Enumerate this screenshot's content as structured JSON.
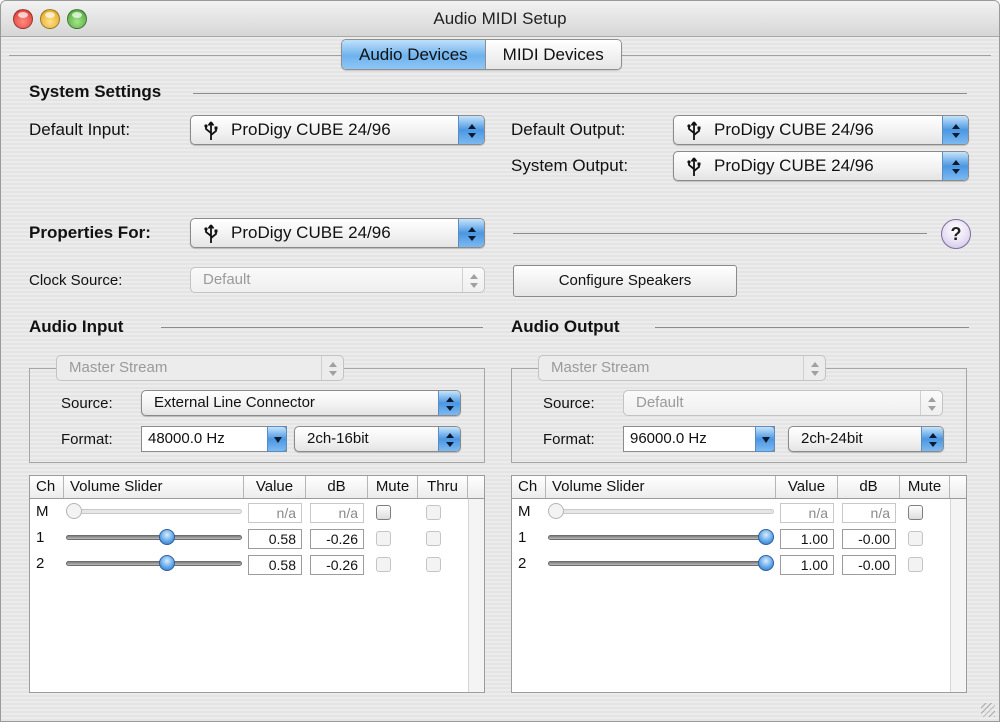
{
  "window": {
    "title": "Audio MIDI Setup"
  },
  "tabs": [
    {
      "label": "Audio Devices",
      "active": true
    },
    {
      "label": "MIDI Devices",
      "active": false
    }
  ],
  "system_settings": {
    "heading": "System Settings",
    "default_input_label": "Default Input:",
    "default_input_value": "ProDigy CUBE 24/96",
    "default_output_label": "Default Output:",
    "default_output_value": "ProDigy CUBE 24/96",
    "system_output_label": "System Output:",
    "system_output_value": "ProDigy CUBE 24/96",
    "device_icon": "usb-icon"
  },
  "properties": {
    "label": "Properties For:",
    "value": "ProDigy CUBE 24/96",
    "help_label": "?",
    "clock_source_label": "Clock Source:",
    "clock_source_value": "Default",
    "configure_speakers_label": "Configure Speakers"
  },
  "audio_input": {
    "heading": "Audio Input",
    "stream": "Master Stream",
    "source_label": "Source:",
    "source_value": "External Line Connector",
    "format_label": "Format:",
    "format_rate": "48000.0 Hz",
    "format_channels": "2ch-16bit",
    "columns": [
      "Ch",
      "Volume Slider",
      "Value",
      "dB",
      "Mute",
      "Thru"
    ],
    "rows": [
      {
        "ch": "M",
        "level": 0.0,
        "enabled": false,
        "value": "n/a",
        "db": "n/a"
      },
      {
        "ch": "1",
        "level": 0.58,
        "enabled": true,
        "value": "0.58",
        "db": "-0.26"
      },
      {
        "ch": "2",
        "level": 0.58,
        "enabled": true,
        "value": "0.58",
        "db": "-0.26"
      }
    ]
  },
  "audio_output": {
    "heading": "Audio Output",
    "stream": "Master Stream",
    "source_label": "Source:",
    "source_value": "Default",
    "format_label": "Format:",
    "format_rate": "96000.0 Hz",
    "format_channels": "2ch-24bit",
    "columns": [
      "Ch",
      "Volume Slider",
      "Value",
      "dB",
      "Mute"
    ],
    "rows": [
      {
        "ch": "M",
        "level": 0.0,
        "enabled": false,
        "value": "n/a",
        "db": "n/a"
      },
      {
        "ch": "1",
        "level": 1.0,
        "enabled": true,
        "value": "1.00",
        "db": "-0.00"
      },
      {
        "ch": "2",
        "level": 1.0,
        "enabled": true,
        "value": "1.00",
        "db": "-0.00"
      }
    ]
  },
  "colors": {
    "accent_blue": "#4b97e2",
    "tab_active": "#6eb2ee"
  }
}
